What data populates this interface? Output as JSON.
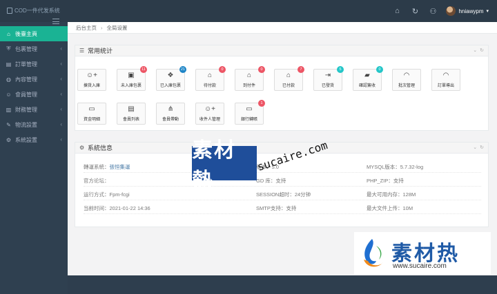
{
  "header": {
    "logo_text": "COD一件代发系统",
    "username": "hniawypm"
  },
  "sidebar": {
    "items": [
      {
        "label": "後臺主頁",
        "icon": "home-icon",
        "glyph": "⌂"
      },
      {
        "label": "包裹管理",
        "icon": "shield-icon",
        "glyph": "⛨"
      },
      {
        "label": "訂單管理",
        "icon": "bag-icon",
        "glyph": "▤"
      },
      {
        "label": "內容管理",
        "icon": "globe-icon",
        "glyph": "◍"
      },
      {
        "label": "會員管理",
        "icon": "user-icon",
        "glyph": "☺"
      },
      {
        "label": "財務管理",
        "icon": "chart-icon",
        "glyph": "▥"
      },
      {
        "label": "物流設置",
        "icon": "wrench-icon",
        "glyph": "✎"
      },
      {
        "label": "系統設置",
        "icon": "gear-icon",
        "glyph": "⚙"
      }
    ]
  },
  "breadcrumb": {
    "home": "后台主页",
    "current": "全局设置"
  },
  "stats": {
    "title": "常用统计",
    "tiles": [
      {
        "label": "揀貨入庫",
        "glyph": "☺+",
        "badge": ""
      },
      {
        "label": "未入庫包裹",
        "glyph": "▣",
        "badge": "11"
      },
      {
        "label": "已入庫包裹",
        "glyph": "❖",
        "badge": "21"
      },
      {
        "label": "待付款",
        "glyph": "⌂",
        "badge": "0"
      },
      {
        "label": "到付件",
        "glyph": "⌂",
        "badge": "0"
      },
      {
        "label": "已付款",
        "glyph": "⌂",
        "badge": "7"
      },
      {
        "label": "已發貨",
        "glyph": "⇥",
        "badge": "5"
      },
      {
        "label": "確認簽收",
        "glyph": "▰",
        "badge": "0"
      },
      {
        "label": "批次管理",
        "glyph": "◠",
        "badge": ""
      },
      {
        "label": "訂單導出",
        "glyph": "◠",
        "badge": ""
      },
      {
        "label": "資金明細",
        "glyph": "▭",
        "badge": ""
      },
      {
        "label": "會員列表",
        "glyph": "▤",
        "badge": ""
      },
      {
        "label": "會員帶動",
        "glyph": "⋔",
        "badge": ""
      },
      {
        "label": "收件人管理",
        "glyph": "☺+",
        "badge": ""
      },
      {
        "label": "銀行轉賬",
        "glyph": "▭",
        "badge": "1"
      }
    ]
  },
  "sysinfo": {
    "title": "系統信息",
    "rows": [
      [
        {
          "label": "轉運系統：",
          "value": "張恒集運"
        },
        {
          "label": "",
          "value": "版本：5.0"
        },
        {
          "label": "MYSQL版本：",
          "value": "5.7.32-log"
        }
      ],
      [
        {
          "label": "官方论坛：",
          "value": ""
        },
        {
          "label": "GD 库：",
          "value": "支持"
        },
        {
          "label": "PHP_ZIP：",
          "value": "支持"
        }
      ],
      [
        {
          "label": "运行方式：",
          "value": "Fpm-fcgi"
        },
        {
          "label": "SESSION超时：",
          "value": "24分钟"
        },
        {
          "label": "最大可用内存：",
          "value": "128M"
        }
      ],
      [
        {
          "label": "当前时间：",
          "value": "2021-01-22 14:36"
        },
        {
          "label": "SMTP支持：",
          "value": "支持"
        },
        {
          "label": "最大文件上传：",
          "value": "10M"
        }
      ]
    ]
  },
  "watermark": {
    "mid_cn": "素材熱",
    "mid_url": "sucaire.com",
    "corner_cn": "素材热",
    "corner_url": "www.sucaire.com"
  },
  "colors": {
    "accent": "#1ab394",
    "sidebar": "#2f4050",
    "badge_red": "#ed5565",
    "badge_blue": "#1c84c6",
    "badge_teal": "#23c6c8"
  }
}
